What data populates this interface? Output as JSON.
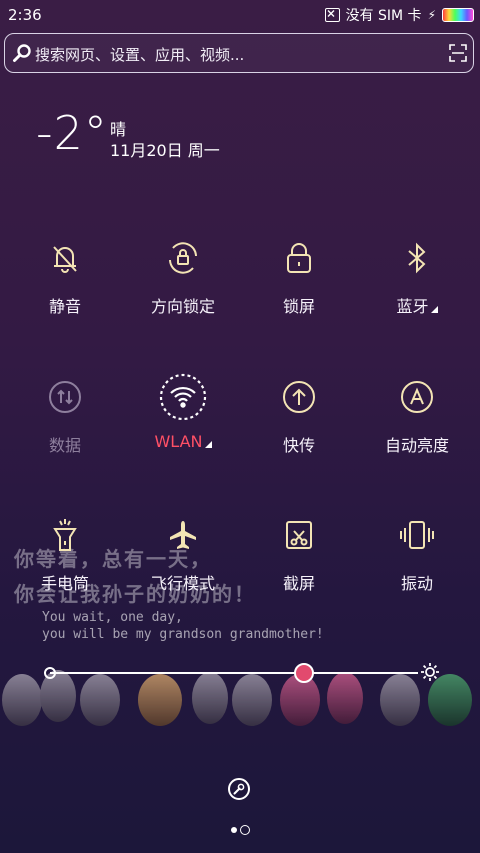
{
  "status_bar": {
    "time": "2:36",
    "carrier": "没有 SIM 卡"
  },
  "search": {
    "placeholder": "搜索网页、设置、应用、视频..."
  },
  "weather": {
    "temperature": "-2°",
    "condition": "晴",
    "date": "11月20日 周一"
  },
  "toggles": [
    {
      "label": "静音",
      "icon": "bell-off-icon"
    },
    {
      "label": "方向锁定",
      "icon": "rotation-lock-icon"
    },
    {
      "label": "锁屏",
      "icon": "lock-icon"
    },
    {
      "label": "蓝牙",
      "icon": "bluetooth-icon"
    },
    {
      "label": "数据",
      "icon": "mobile-data-icon"
    },
    {
      "label": "WLAN",
      "icon": "wifi-icon"
    },
    {
      "label": "快传",
      "icon": "transfer-icon"
    },
    {
      "label": "自动亮度",
      "icon": "auto-brightness-icon"
    },
    {
      "label": "手电筒",
      "icon": "flashlight-icon"
    },
    {
      "label": "飞行模式",
      "icon": "airplane-icon"
    },
    {
      "label": "截屏",
      "icon": "screenshot-icon"
    },
    {
      "label": "振动",
      "icon": "vibrate-icon"
    }
  ],
  "wallpaper_text": {
    "line1": "你等着，总有一天，",
    "line2": "你会让我孙子的奶奶的！",
    "line3": "You wait, one day,",
    "line4": "you will be my grandson grandmother!"
  },
  "brightness": {
    "value": 0.69
  },
  "colors": {
    "accent": "#ff5066",
    "icon": "#f3e4b4"
  }
}
